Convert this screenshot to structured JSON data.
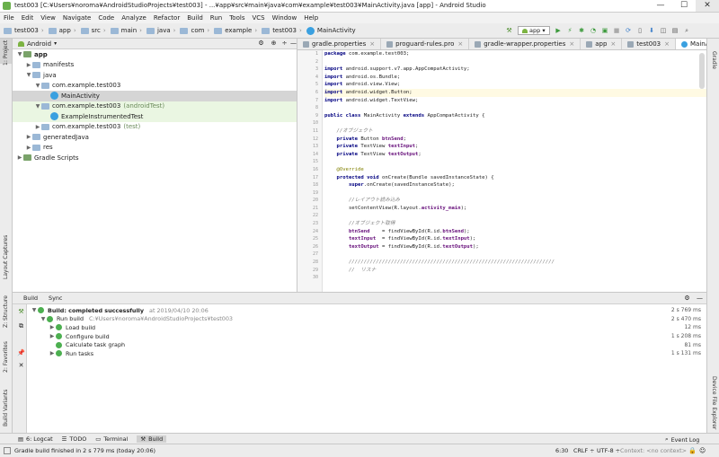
{
  "window": {
    "title": "test003 [C:¥Users¥noroma¥AndroidStudioProjects¥test003] - ...¥app¥src¥main¥java¥com¥example¥test003¥MainActivity.java [app] - Android Studio",
    "min": "—",
    "max": "☐",
    "close": "✕"
  },
  "menu": [
    "File",
    "Edit",
    "View",
    "Navigate",
    "Code",
    "Analyze",
    "Refactor",
    "Build",
    "Run",
    "Tools",
    "VCS",
    "Window",
    "Help"
  ],
  "breadcrumb": [
    "test003",
    "app",
    "src",
    "main",
    "java",
    "com",
    "example",
    "test003",
    "MainActivity"
  ],
  "toolbar": {
    "run_config": "app"
  },
  "project": {
    "view_mode": "Android",
    "tree": [
      {
        "label": "app",
        "level": 0,
        "arrow": "▼",
        "icon": "folder",
        "bold": true
      },
      {
        "label": "manifests",
        "level": 1,
        "arrow": "▶",
        "icon": "folder"
      },
      {
        "label": "java",
        "level": 1,
        "arrow": "▼",
        "icon": "folder"
      },
      {
        "label": "com.example.test003",
        "level": 2,
        "arrow": "▼",
        "icon": "folder"
      },
      {
        "label": "MainActivity",
        "level": 3,
        "arrow": "",
        "icon": "class",
        "selected": true
      },
      {
        "label": "com.example.test003",
        "suffix": "(androidTest)",
        "level": 2,
        "arrow": "▼",
        "icon": "folder",
        "test": true
      },
      {
        "label": "ExampleInstrumentedTest",
        "level": 3,
        "arrow": "",
        "icon": "class",
        "test": true
      },
      {
        "label": "com.example.test003",
        "suffix": "(test)",
        "level": 2,
        "arrow": "▶",
        "icon": "folder"
      },
      {
        "label": "generatedJava",
        "level": 1,
        "arrow": "▶",
        "icon": "folder"
      },
      {
        "label": "res",
        "level": 1,
        "arrow": "▶",
        "icon": "folder"
      },
      {
        "label": "Gradle Scripts",
        "level": 0,
        "arrow": "▶",
        "icon": "gradle"
      }
    ]
  },
  "editor": {
    "tabs": [
      "gradle.properties",
      "proguard-rules.pro",
      "gradle-wrapper.properties",
      "app",
      "test003",
      "MainActivity.java"
    ],
    "active_tab": "MainActivity.java",
    "line_numbers": [
      "1",
      "2",
      "3",
      "4",
      "5",
      "6",
      "7",
      "8",
      "9",
      "10",
      "11",
      "12",
      "13",
      "14",
      "15",
      "16",
      "17",
      "18",
      "19",
      "20",
      "21",
      "22",
      "23",
      "24",
      "25",
      "26",
      "27",
      "28",
      "29",
      "30"
    ],
    "lines": [
      {
        "segs": [
          {
            "c": "kw",
            "t": "package "
          },
          {
            "c": "",
            "t": "com.example.test003;"
          }
        ]
      },
      {
        "segs": []
      },
      {
        "segs": [
          {
            "c": "kw",
            "t": "import "
          },
          {
            "c": "",
            "t": "android.support.v7.app.AppCompatActivity;"
          }
        ]
      },
      {
        "segs": [
          {
            "c": "kw",
            "t": "import "
          },
          {
            "c": "",
            "t": "android.os.Bundle;"
          }
        ]
      },
      {
        "segs": [
          {
            "c": "kw",
            "t": "import "
          },
          {
            "c": "",
            "t": "android.view.View;"
          }
        ]
      },
      {
        "segs": [
          {
            "c": "kw",
            "t": "import "
          },
          {
            "c": "",
            "t": "android.widget.Button;"
          }
        ]
      },
      {
        "segs": [
          {
            "c": "kw",
            "t": "import "
          },
          {
            "c": "",
            "t": "android.widget.TextView;"
          }
        ]
      },
      {
        "segs": []
      },
      {
        "segs": [
          {
            "c": "kw",
            "t": "public class "
          },
          {
            "c": "",
            "t": "MainActivity "
          },
          {
            "c": "kw",
            "t": "extends "
          },
          {
            "c": "",
            "t": "AppCompatActivity {"
          }
        ]
      },
      {
        "segs": []
      },
      {
        "segs": [
          {
            "c": "cm",
            "t": "    //オブジェクト"
          }
        ]
      },
      {
        "segs": [
          {
            "c": "kw",
            "t": "    private "
          },
          {
            "c": "",
            "t": "Button "
          },
          {
            "c": "fd",
            "t": "btnSend"
          },
          {
            "c": "",
            "t": ";"
          }
        ]
      },
      {
        "segs": [
          {
            "c": "kw",
            "t": "    private "
          },
          {
            "c": "",
            "t": "TextView "
          },
          {
            "c": "fd",
            "t": "textInput"
          },
          {
            "c": "",
            "t": ";"
          }
        ]
      },
      {
        "segs": [
          {
            "c": "kw",
            "t": "    private "
          },
          {
            "c": "",
            "t": "TextView "
          },
          {
            "c": "fd",
            "t": "textOutput"
          },
          {
            "c": "",
            "t": ";"
          }
        ]
      },
      {
        "segs": []
      },
      {
        "segs": [
          {
            "c": "an",
            "t": "    @Override"
          }
        ]
      },
      {
        "segs": [
          {
            "c": "kw",
            "t": "    protected void "
          },
          {
            "c": "",
            "t": "onCreate(Bundle savedInstanceState) {"
          }
        ]
      },
      {
        "segs": [
          {
            "c": "kw",
            "t": "        super"
          },
          {
            "c": "",
            "t": ".onCreate(savedInstanceState);"
          }
        ]
      },
      {
        "segs": []
      },
      {
        "segs": [
          {
            "c": "cm",
            "t": "        //レイアウト読み込み"
          }
        ]
      },
      {
        "segs": [
          {
            "c": "",
            "t": "        setContentView(R.layout."
          },
          {
            "c": "fd",
            "t": "activity_main"
          },
          {
            "c": "",
            "t": ");"
          }
        ]
      },
      {
        "segs": []
      },
      {
        "segs": [
          {
            "c": "cm",
            "t": "        //オブジェクト取得"
          }
        ]
      },
      {
        "segs": [
          {
            "c": "fd",
            "t": "        btnSend"
          },
          {
            "c": "",
            "t": "    = findViewById(R.id."
          },
          {
            "c": "fd",
            "t": "btnSend"
          },
          {
            "c": "",
            "t": ");"
          }
        ]
      },
      {
        "segs": [
          {
            "c": "fd",
            "t": "        textInput"
          },
          {
            "c": "",
            "t": "  = findViewById(R.id."
          },
          {
            "c": "fd",
            "t": "textInput"
          },
          {
            "c": "",
            "t": ");"
          }
        ]
      },
      {
        "segs": [
          {
            "c": "fd",
            "t": "        textOutput"
          },
          {
            "c": "",
            "t": " = findViewById(R.id."
          },
          {
            "c": "fd",
            "t": "textOutput"
          },
          {
            "c": "",
            "t": ");"
          }
        ]
      },
      {
        "segs": []
      },
      {
        "segs": [
          {
            "c": "cm",
            "t": "        ////////////////////////////////////////////////////////////////////"
          }
        ]
      },
      {
        "segs": [
          {
            "c": "cm",
            "t": "        //  リスナ"
          }
        ]
      },
      {
        "segs": []
      }
    ]
  },
  "build": {
    "tabs": [
      "Build",
      "Sync"
    ],
    "rows": [
      {
        "label": "Build: completed successfully",
        "meta": "at 2019/04/10 20:06",
        "dur": "2 s 769 ms",
        "level": 0,
        "arrow": "▼",
        "bold": true
      },
      {
        "label": "Run build",
        "meta": "C:¥Users¥noroma¥AndroidStudioProjects¥test003",
        "dur": "2 s 470 ms",
        "level": 1,
        "arrow": "▼"
      },
      {
        "label": "Load build",
        "meta": "",
        "dur": "12 ms",
        "level": 2,
        "arrow": "▶"
      },
      {
        "label": "Configure build",
        "meta": "",
        "dur": "1 s 208 ms",
        "level": 2,
        "arrow": "▶"
      },
      {
        "label": "Calculate task graph",
        "meta": "",
        "dur": "81 ms",
        "level": 2,
        "arrow": ""
      },
      {
        "label": "Run tasks",
        "meta": "",
        "dur": "1 s 131 ms",
        "level": 2,
        "arrow": "▶"
      }
    ]
  },
  "side_tabs": {
    "left_top": "1: Project",
    "left_mid1": "Layout Captures",
    "left_mid2": "Z: Structure",
    "left_bot1": "2: Favorites",
    "left_bot2": "Build Variants",
    "right_top": "Gradle",
    "right_bot": "Device File Explorer"
  },
  "bottom_tabs": [
    "6: Logcat",
    "TODO",
    "Terminal",
    "Build"
  ],
  "event_log": "Event Log",
  "status": {
    "message": "Gradle build finished in 2 s 779 ms (today 20:06)",
    "position": "6:30",
    "line_sep": "CRLF ÷",
    "encoding": "UTF-8 ÷",
    "context": "Context: <no context>"
  }
}
